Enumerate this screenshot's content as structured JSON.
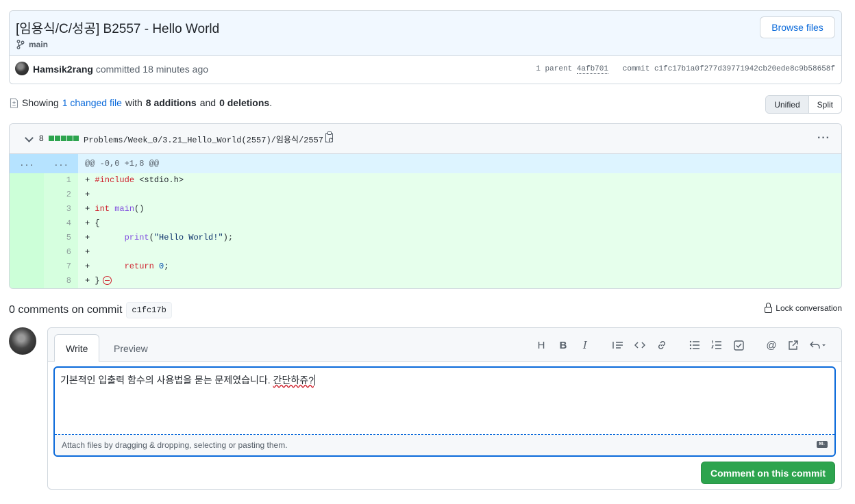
{
  "commit": {
    "title": "[임용식/C/성공] B2557 - Hello World",
    "branch": "main",
    "browse_label": "Browse files",
    "author": "Hamsik2rang",
    "committed_text": "committed 18 minutes ago",
    "parent_prefix": "1 parent",
    "parent_sha": "4afb701",
    "commit_prefix": "commit",
    "commit_sha": "c1fc17b1a0f277d39771942cb20ede8c9b58658f"
  },
  "summary": {
    "showing": "Showing",
    "changed": "1 changed file",
    "with": "with",
    "additions": "8 additions",
    "and": "and",
    "deletions": "0 deletions",
    "period": "."
  },
  "view_toggle": {
    "unified": "Unified",
    "split": "Split",
    "selected": "Unified"
  },
  "file": {
    "change_count": "8",
    "path": "Problems/Week_0/3.21_Hello_World(2557)/임용식/2557.c",
    "hunk_left": "...",
    "hunk_right": "...",
    "hunk_header": "@@ -0,0 +1,8 @@",
    "lines": [
      {
        "num": "1",
        "text": "#include <stdio.h>"
      },
      {
        "num": "2",
        "text": ""
      },
      {
        "num": "3",
        "text": "int main()"
      },
      {
        "num": "4",
        "text": "{"
      },
      {
        "num": "5",
        "text": "      print(\"Hello World!\");"
      },
      {
        "num": "6",
        "text": ""
      },
      {
        "num": "7",
        "text": "      return 0;"
      },
      {
        "num": "8",
        "text": "}"
      }
    ]
  },
  "comments": {
    "title": "0 comments on commit",
    "sha": "c1fc17b",
    "lock_label": "Lock conversation"
  },
  "editor": {
    "tab_write": "Write",
    "tab_preview": "Preview",
    "text": "기본적인 입출력 함수의 사용법을 묻는 문제였습니다.",
    "text_misspelled": "간단하쥬?",
    "attach_hint": "Attach files by dragging & dropping, selecting or pasting them.",
    "md_badge": "M↓",
    "submit_label": "Comment on this commit"
  },
  "colors": {
    "accent": "#0969da",
    "added_bg": "#e6ffec",
    "submit": "#2da44e"
  }
}
